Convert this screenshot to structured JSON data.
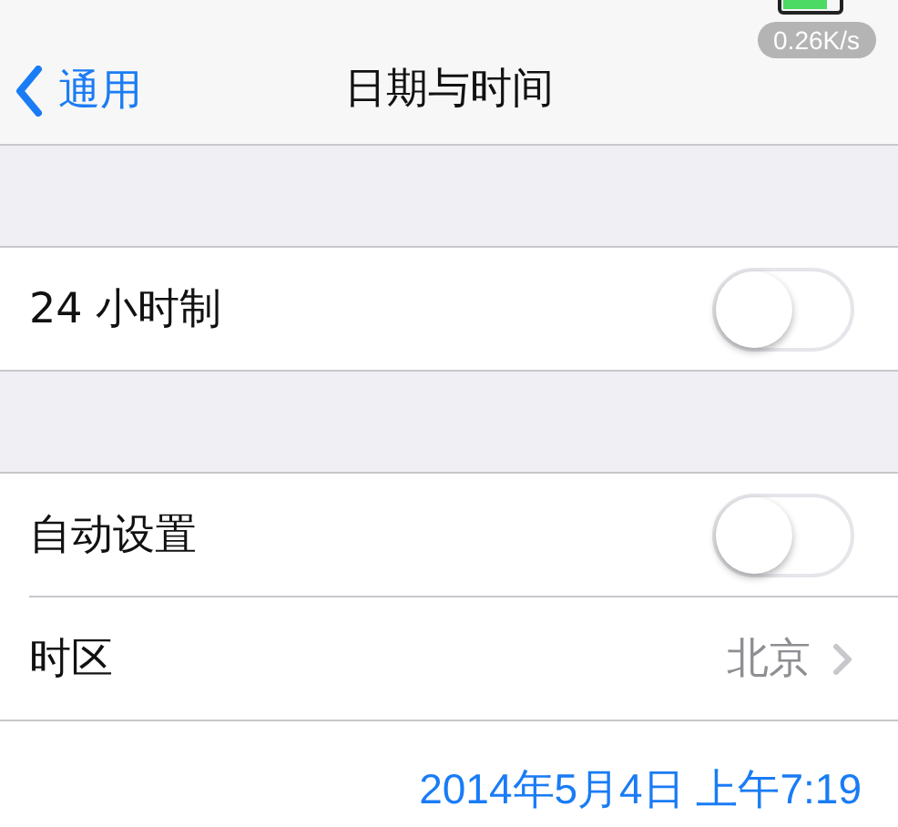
{
  "nav": {
    "back": "通用",
    "title": "日期与时间",
    "speed_badge": "0.26K/s"
  },
  "sections": [
    [
      {
        "kind": "toggle",
        "label": "24 小时制",
        "on": false
      }
    ],
    [
      {
        "kind": "toggle",
        "label": "自动设置",
        "on": false
      },
      {
        "kind": "detail",
        "label": "时区",
        "value": "北京"
      }
    ]
  ],
  "date_time": "2014年5月4日 上午7:19"
}
